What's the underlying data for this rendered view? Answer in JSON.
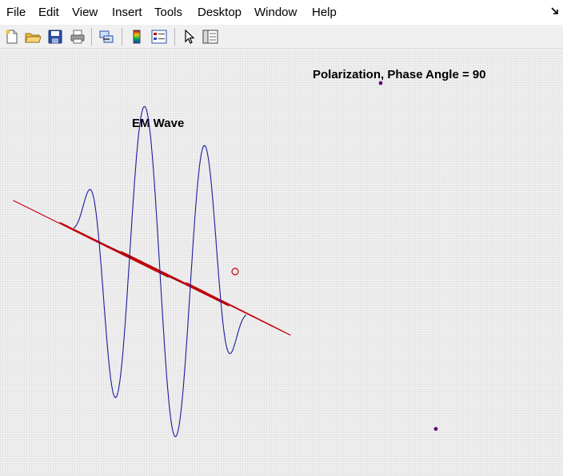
{
  "menubar": {
    "items": [
      "File",
      "Edit",
      "View",
      "Insert",
      "Tools",
      "Desktop",
      "Window",
      "Help"
    ]
  },
  "toolbar": {
    "buttons": [
      {
        "icon": "new-figure-icon"
      },
      {
        "icon": "open-file-icon"
      },
      {
        "icon": "save-icon"
      },
      {
        "icon": "print-icon"
      },
      {
        "icon": "link-plot-icon"
      },
      {
        "icon": "colorbar-icon"
      },
      {
        "icon": "legend-icon"
      },
      {
        "icon": "pointer-icon"
      },
      {
        "icon": "property-inspector-icon"
      }
    ]
  },
  "figure": {
    "polarization_title": "Polarization, Phase Angle = 90",
    "wave_title": "EM Wave",
    "colors": {
      "e_field": "#c0000c",
      "b_field": "#1c1c9c",
      "axes": "#000000",
      "marker": "#c0000c",
      "dot": "#5a0a7a"
    }
  }
}
